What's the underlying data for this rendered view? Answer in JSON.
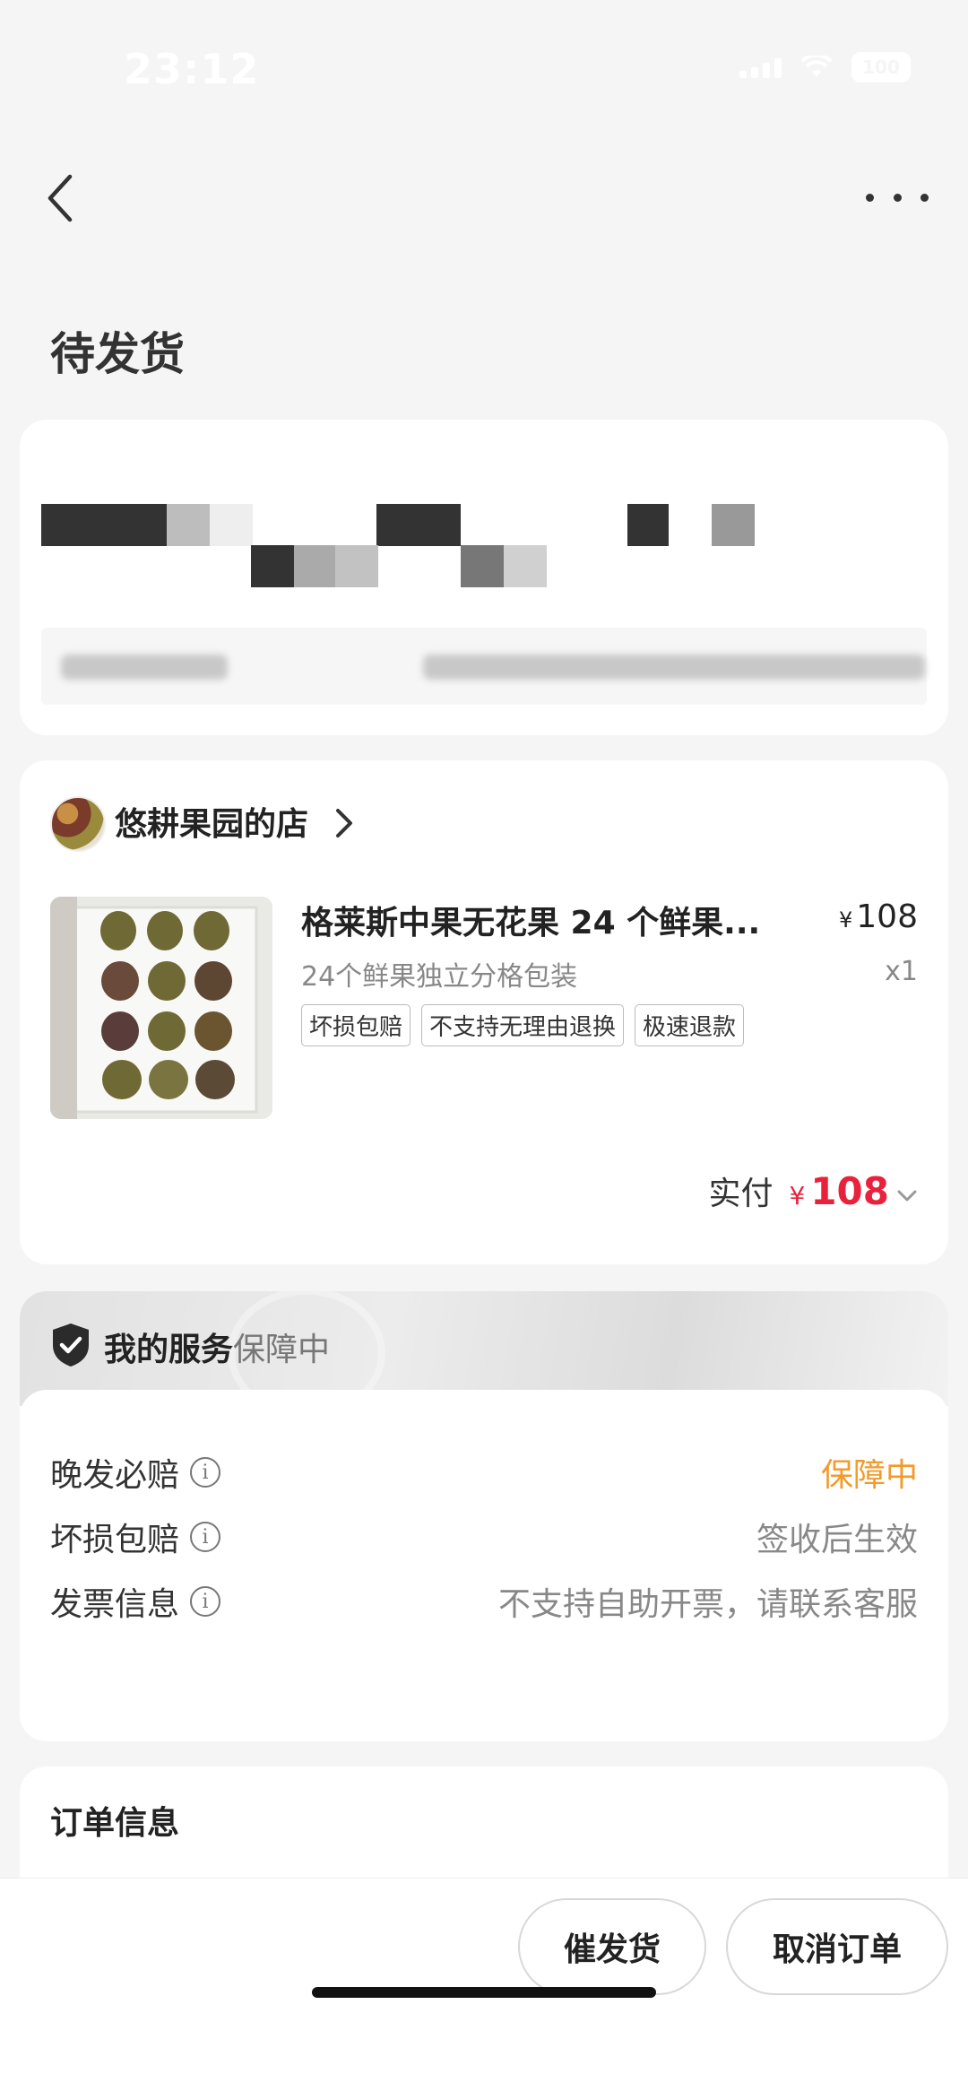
{
  "status_bar": {
    "time": "23:12",
    "battery": "100"
  },
  "header": {
    "title": "待发货"
  },
  "order": {
    "shop_name": "悠耕果园的店",
    "product_title": "格莱斯中果无花果 24 个鲜果...",
    "price_symbol": "¥",
    "price": "108",
    "spec": "24个鲜果独立分格包装",
    "quantity": "x1",
    "tags": [
      "坏损包赔",
      "不支持无理由退换",
      "极速退款"
    ],
    "paid_label": "实付",
    "paid_symbol": "¥",
    "paid_amount": "108"
  },
  "service": {
    "title": "我的服务",
    "title_status": "保障中",
    "rows": [
      {
        "label": "晚发必赔",
        "value": "保障中",
        "value_color": "#f39a2b"
      },
      {
        "label": "坏损包赔",
        "value": "签收后生效"
      },
      {
        "label": "发票信息",
        "value": "不支持自助开票，请联系客服"
      }
    ],
    "info_glyph": "i"
  },
  "order_info": {
    "title": "订单信息"
  },
  "bottom": {
    "urge_label": "催发货",
    "cancel_label": "取消订单"
  },
  "colors": {
    "price_red": "#e8223d",
    "guarantee_orange": "#f39a2b"
  }
}
